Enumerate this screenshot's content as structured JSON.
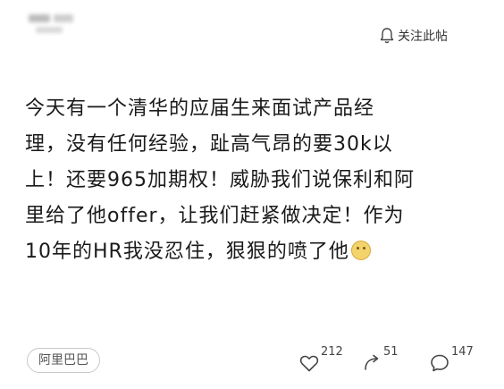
{
  "post": {
    "author_blurred": true,
    "follow_label": "关注此帖",
    "content_lines": [
      "今天有一个清华的应届生来面试产品经",
      "理，没有任何经验，趾高气昂的要30k以",
      "上！还要965加期权！威胁我们说保利和阿",
      "里给了他offer，让我们赶紧做决定！作为",
      "10年的HR我没忍住，狠狠的喷了他"
    ],
    "tag": "阿里巴巴",
    "stats": {
      "likes": "212",
      "reposts": "51",
      "comments": "147"
    }
  },
  "icons": {
    "follow": "bell-icon",
    "like": "heart-icon",
    "repost": "repost-icon",
    "comment": "comment-bubble-icon",
    "emoji": "emoji-icon"
  }
}
